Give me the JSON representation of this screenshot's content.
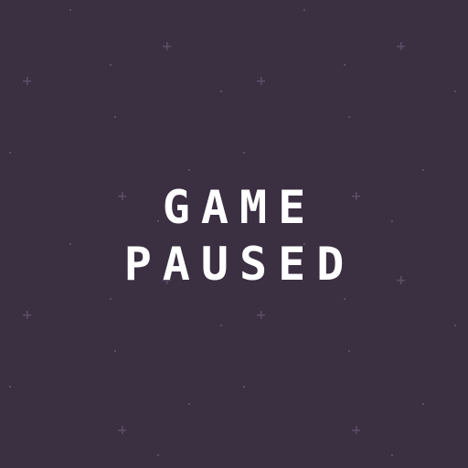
{
  "screen": {
    "title_line_1": "GAME",
    "title_line_2": "PAUSED"
  },
  "colors": {
    "background": "#3b2f42",
    "text": "#ffffff",
    "star": "#5d4e66"
  }
}
